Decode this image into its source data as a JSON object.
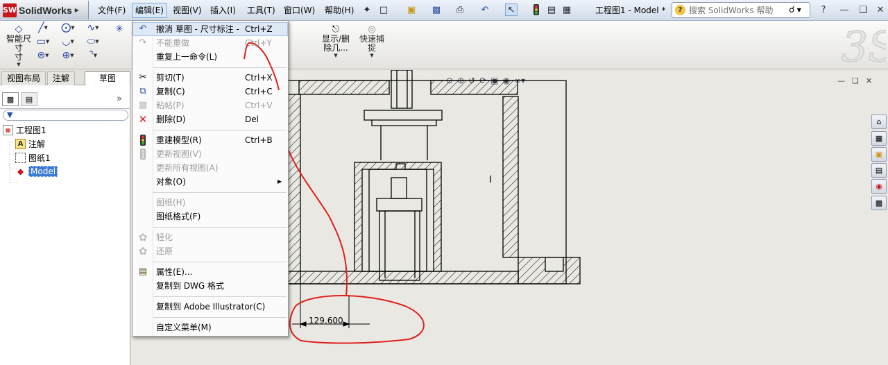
{
  "app": {
    "brand_prefix": "SW",
    "brand_name": "SolidWorks"
  },
  "menubar": [
    {
      "label": "文件(F)",
      "active": false
    },
    {
      "label": "编辑(E)",
      "active": true
    },
    {
      "label": "视图(V)",
      "active": false
    },
    {
      "label": "插入(I)",
      "active": false
    },
    {
      "label": "工具(T)",
      "active": false
    },
    {
      "label": "窗口(W)",
      "active": false
    },
    {
      "label": "帮助(H)",
      "active": false
    }
  ],
  "window_title": "工程图1 - Model *",
  "search": {
    "placeholder": "搜索 SolidWorks 帮助",
    "help_glyph": "?"
  },
  "ribbon": {
    "smart_dim_label": "智能尺寸",
    "smart_dim_line2": "寸",
    "show_hide_label": "显示/删",
    "show_hide_line2": "除几...",
    "quick_snap_label": "快速捕",
    "quick_snap_line2": "捉"
  },
  "panel_tabs": [
    {
      "label": "视图布局",
      "selected": false
    },
    {
      "label": "注解",
      "selected": false
    },
    {
      "label": "草图",
      "selected": true
    }
  ],
  "feature_tree": [
    {
      "label": "工程图1",
      "level": 0,
      "icon": "drawing-icon",
      "selected": false
    },
    {
      "label": "注解",
      "level": 1,
      "icon": "annotation-icon",
      "selected": false
    },
    {
      "label": "图纸1",
      "level": 1,
      "icon": "sheet-icon",
      "selected": false
    },
    {
      "label": "Model",
      "level": 1,
      "icon": "model-icon",
      "selected": true
    }
  ],
  "edit_menu": [
    {
      "label": "撤消 草图 - 尺寸标注 -",
      "shortcut": "Ctrl+Z",
      "icon": "undo-icon",
      "disabled": false,
      "highlighted": true
    },
    {
      "label": "不能重做",
      "shortcut": "Ctrl+Y",
      "icon": "redo-icon",
      "disabled": true
    },
    {
      "label": "重复上一命令(L)",
      "shortcut": "",
      "icon": "",
      "disabled": false
    },
    {
      "label": "剪切(T)",
      "shortcut": "Ctrl+X",
      "icon": "scissors-icon",
      "disabled": false
    },
    {
      "label": "复制(C)",
      "shortcut": "Ctrl+C",
      "icon": "copy-icon",
      "disabled": false
    },
    {
      "label": "粘帖(P)",
      "shortcut": "Ctrl+V",
      "icon": "paste-icon",
      "disabled": true
    },
    {
      "label": "删除(D)",
      "shortcut": "Del",
      "icon": "delete-icon",
      "disabled": false
    },
    {
      "label": "重建模型(R)",
      "shortcut": "Ctrl+B",
      "icon": "rebuild-icon",
      "disabled": false
    },
    {
      "label": "更新视图(V)",
      "shortcut": "",
      "icon": "update-view-icon",
      "disabled": true
    },
    {
      "label": "更新所有视图(A)",
      "shortcut": "",
      "icon": "",
      "disabled": true
    },
    {
      "label": "对象(O)",
      "shortcut": "",
      "icon": "",
      "disabled": false,
      "submenu": true
    },
    {
      "label": "图纸(H)",
      "shortcut": "",
      "icon": "",
      "disabled": true
    },
    {
      "label": "图纸格式(F)",
      "shortcut": "",
      "icon": "",
      "disabled": false
    },
    {
      "label": "轻化",
      "shortcut": "",
      "icon": "lightweight-icon",
      "disabled": true
    },
    {
      "label": "还原",
      "shortcut": "",
      "icon": "resolve-icon",
      "disabled": true
    },
    {
      "label": "属性(E)...",
      "shortcut": "",
      "icon": "properties-icon",
      "disabled": false
    },
    {
      "label": "复制到 DWG 格式",
      "shortcut": "",
      "icon": "",
      "disabled": false
    },
    {
      "label": "复制到 Adobe Illustrator(C)",
      "shortcut": "",
      "icon": "",
      "disabled": false
    },
    {
      "label": "自定义菜单(M)",
      "shortcut": "",
      "icon": "",
      "disabled": false
    }
  ],
  "drawing": {
    "dimension_value": "129.600"
  },
  "colors": {
    "annotation_red": "#e0201b",
    "menu_highlight": "#dfe9f6",
    "selection_blue": "#3a7bd5"
  }
}
